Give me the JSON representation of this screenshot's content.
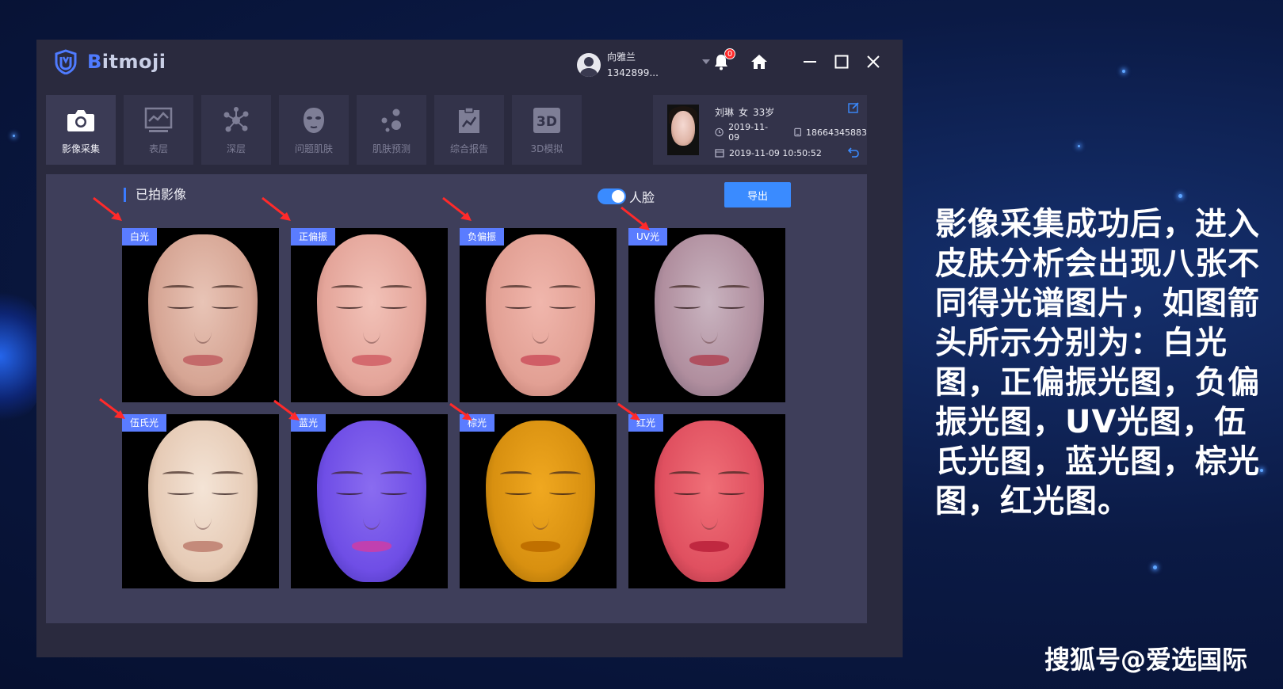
{
  "app": {
    "brand_first": "B",
    "brand_rest": "itmoji"
  },
  "user": {
    "name": "向雅兰",
    "phone": "1342899..."
  },
  "notifications": {
    "count": "0"
  },
  "toolbar": {
    "items": [
      {
        "label": "影像采集",
        "icon": "camera-icon"
      },
      {
        "label": "表层",
        "icon": "surface-chart-icon"
      },
      {
        "label": "深层",
        "icon": "molecule-icon"
      },
      {
        "label": "问题肌肤",
        "icon": "face-mask-icon"
      },
      {
        "label": "肌肤预测",
        "icon": "dots-icon"
      },
      {
        "label": "综合报告",
        "icon": "report-icon"
      },
      {
        "label": "3D模拟",
        "icon": "3d-icon"
      }
    ]
  },
  "patient": {
    "name": "刘琳",
    "gender": "女",
    "age": "33岁",
    "date": "2019-11-09",
    "phone": "18664345883",
    "datetime": "2019-11-09 10:50:52"
  },
  "section": {
    "title": "已拍影像",
    "toggle_label": "人脸",
    "toggle_on": true,
    "export_label": "导出"
  },
  "images": [
    {
      "label": "白光",
      "skin": "#e8c4b6",
      "mid": "#d6a594",
      "edge": "#8a5a4e",
      "lip": "#c46a6a"
    },
    {
      "label": "正偏振",
      "skin": "#f2c2b8",
      "mid": "#e4a59a",
      "edge": "#a56a60",
      "lip": "#d46a6e"
    },
    {
      "label": "负偏振",
      "skin": "#f0b6ac",
      "mid": "#e2a094",
      "edge": "#a8685e",
      "lip": "#d05e66"
    },
    {
      "label": "UV光",
      "skin": "#c9b4c0",
      "mid": "#b08e9e",
      "edge": "#6a5a6e",
      "lip": "#b05060"
    },
    {
      "label": "伍氏光",
      "skin": "#f4e4d6",
      "mid": "#e6cbb6",
      "edge": "#a08068",
      "lip": "#c48a7a"
    },
    {
      "label": "蓝光",
      "skin": "#8a6cf0",
      "mid": "#6f4ee6",
      "edge": "#3a2aa0",
      "lip": "#c040b0"
    },
    {
      "label": "棕光",
      "skin": "#f0a820",
      "mid": "#d89010",
      "edge": "#8a5a00",
      "lip": "#c07000"
    },
    {
      "label": "红光",
      "skin": "#f07078",
      "mid": "#e05060",
      "edge": "#902838",
      "lip": "#c02840"
    }
  ],
  "caption": "影像采集成功后，进入皮肤分析会出现八张不同得光谱图片，如图箭头所示分别为：白光图，正偏振光图，负偏振光图，UV光图，伍氏光图，蓝光图，棕光图，红光图。",
  "watermark": "搜狐号@爱选国际",
  "colors": {
    "accent": "#3a8bff",
    "tag": "#5a7cff",
    "arrow": "#ff2a2a"
  }
}
